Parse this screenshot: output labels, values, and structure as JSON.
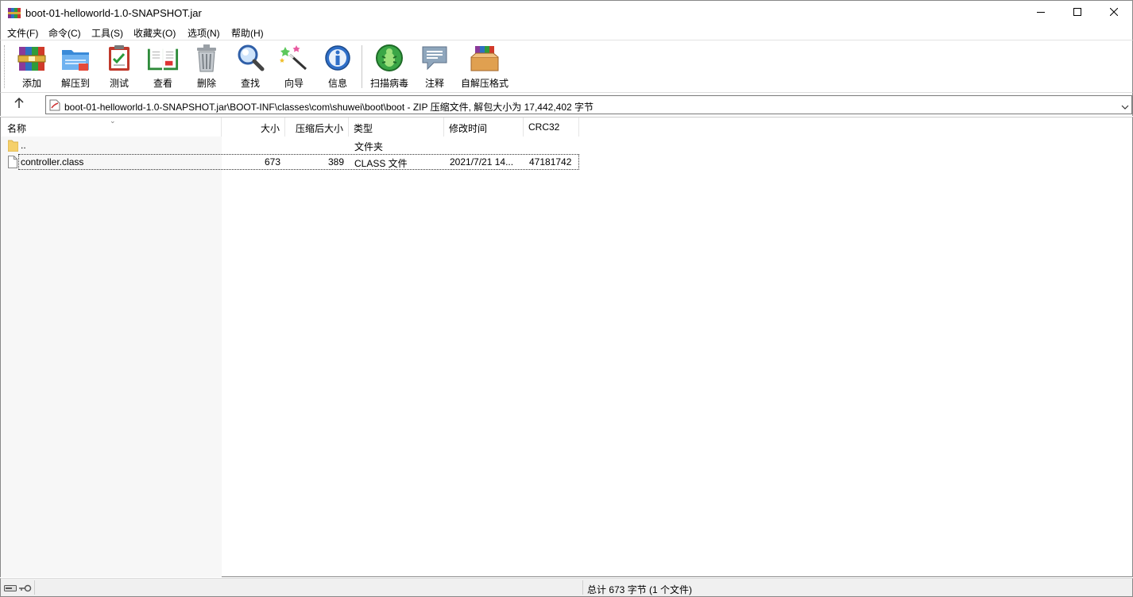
{
  "window": {
    "title": "boot-01-helloworld-1.0-SNAPSHOT.jar",
    "minimize_icon": "minimize-icon",
    "maximize_icon": "maximize-icon",
    "close_icon": "close-icon"
  },
  "menu": [
    "文件(F)",
    "命令(C)",
    "工具(S)",
    "收藏夹(O)",
    "选项(N)",
    "帮助(H)"
  ],
  "toolbar": {
    "buttons": [
      {
        "label": "添加",
        "icon": "books-stack-icon"
      },
      {
        "label": "解压到",
        "icon": "folder-extract-icon"
      },
      {
        "label": "测试",
        "icon": "clipboard-check-icon"
      },
      {
        "label": "查看",
        "icon": "open-book-icon"
      },
      {
        "label": "删除",
        "icon": "trash-icon"
      },
      {
        "label": "查找",
        "icon": "magnifier-icon"
      },
      {
        "label": "向导",
        "icon": "magic-wand-icon"
      },
      {
        "label": "信息",
        "icon": "info-icon"
      },
      {
        "label": "扫描病毒",
        "icon": "bug-scan-icon"
      },
      {
        "label": "注释",
        "icon": "comment-icon"
      },
      {
        "label": "自解压格式",
        "icon": "sfx-box-icon"
      }
    ]
  },
  "address": {
    "path": "boot-01-helloworld-1.0-SNAPSHOT.jar\\BOOT-INF\\classes\\com\\shuwei\\boot\\boot - ZIP 压缩文件, 解包大小为 17,442,402 字节"
  },
  "columns": {
    "name": "名称",
    "size": "大小",
    "packed": "压缩后大小",
    "type": "类型",
    "modified": "修改时间",
    "crc": "CRC32"
  },
  "files": [
    {
      "name": "..",
      "size": "",
      "packed": "",
      "type": "文件夹",
      "modified": "",
      "crc": "",
      "icon": "folder-icon"
    },
    {
      "name": "controller.class",
      "size": "673",
      "packed": "389",
      "type": "CLASS 文件",
      "modified": "2021/7/21 14...",
      "crc": "47181742",
      "icon": "file-icon"
    }
  ],
  "status": {
    "text": "总计 673 字节 (1 个文件)"
  },
  "colors": {
    "selection_outline": "#333333",
    "name_column_bg": "#f7f7f7",
    "status_bg": "#f0f0f0"
  }
}
